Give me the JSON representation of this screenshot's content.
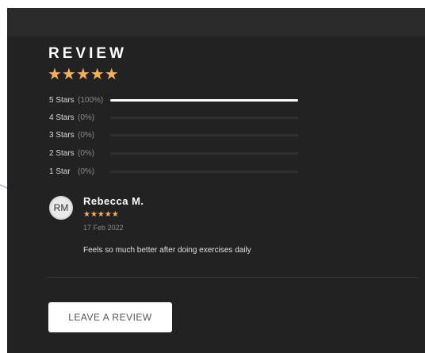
{
  "review_section": {
    "title": "REVIEW",
    "overall_stars": "★★★★★",
    "breakdown": [
      {
        "label": "5 Stars",
        "pct_label": "(100%)",
        "fraction": 1.0
      },
      {
        "label": "4 Stars",
        "pct_label": "(0%)",
        "fraction": 0.0
      },
      {
        "label": "3 Stars",
        "pct_label": "(0%)",
        "fraction": 0.0
      },
      {
        "label": "2 Stars",
        "pct_label": "(0%)",
        "fraction": 0.0
      },
      {
        "label": "1 Star",
        "pct_label": "(0%)",
        "fraction": 0.0
      }
    ]
  },
  "review": {
    "initials": "RM",
    "name": "Rebecca M.",
    "stars": "★★★★★",
    "date": "17 Feb 2022",
    "text": "Feels so much better after doing exercises daily"
  },
  "actions": {
    "leave_review_label": "LEAVE A REVIEW"
  },
  "colors": {
    "panel_bg": "#222222",
    "star_accent": "#f3b05a",
    "bar_fill": "#ffffff"
  }
}
